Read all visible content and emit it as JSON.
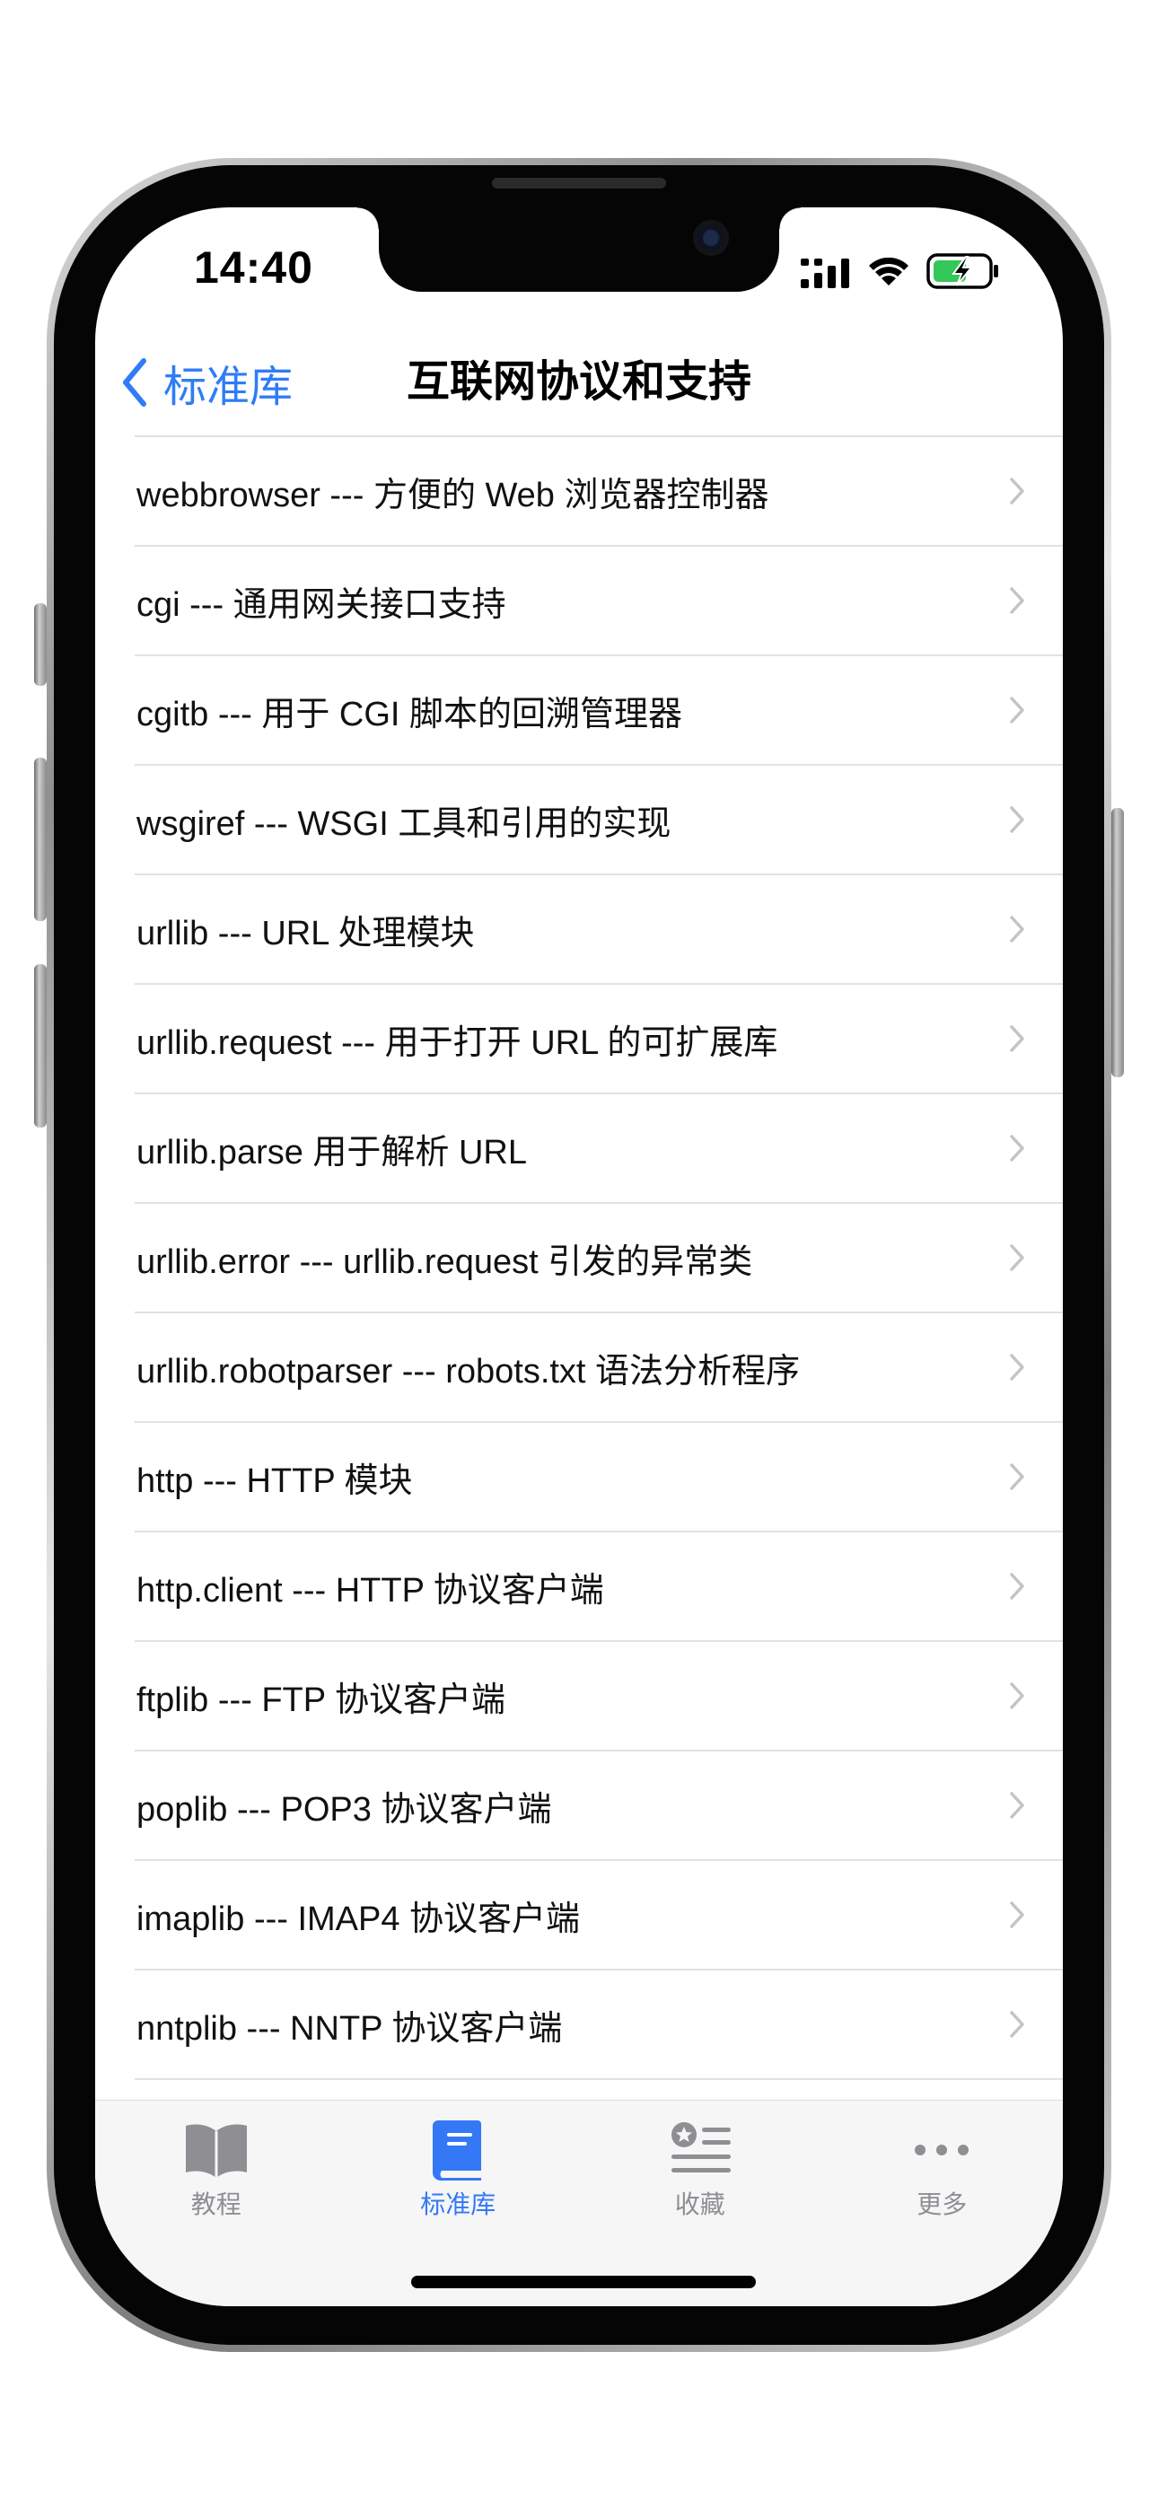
{
  "status_bar": {
    "time": "14:40"
  },
  "nav": {
    "back_label": "标准库",
    "title": "互联网协议和支持"
  },
  "list": {
    "items": [
      {
        "label": "webbrowser --- 方便的 Web 浏览器控制器"
      },
      {
        "label": "cgi --- 通用网关接口支持"
      },
      {
        "label": "cgitb --- 用于 CGI 脚本的回溯管理器"
      },
      {
        "label": "wsgiref --- WSGI 工具和引用的实现"
      },
      {
        "label": "urllib --- URL 处理模块"
      },
      {
        "label": "urllib.request --- 用于打开 URL 的可扩展库"
      },
      {
        "label": "urllib.parse  用于解析 URL"
      },
      {
        "label": "urllib.error --- urllib.request 引发的异常类"
      },
      {
        "label": "urllib.robotparser --- robots.txt 语法分析程序"
      },
      {
        "label": "http --- HTTP 模块"
      },
      {
        "label": "http.client --- HTTP 协议客户端"
      },
      {
        "label": "ftplib --- FTP 协议客户端"
      },
      {
        "label": "poplib --- POP3 协议客户端"
      },
      {
        "label": "imaplib --- IMAP4 协议客户端"
      },
      {
        "label": "nntplib --- NNTP 协议客户端"
      },
      {
        "label": ""
      }
    ]
  },
  "tab_bar": {
    "tabs": [
      {
        "label": "教程",
        "icon": "book-open-icon",
        "active": false
      },
      {
        "label": "标准库",
        "icon": "book-closed-icon",
        "active": true
      },
      {
        "label": "收藏",
        "icon": "star-list-icon",
        "active": false
      },
      {
        "label": "更多",
        "icon": "ellipsis-icon",
        "active": false
      }
    ]
  },
  "colors": {
    "accent": "#3478f6",
    "inactive": "#8e8e93",
    "battery_fill": "#34c759"
  }
}
